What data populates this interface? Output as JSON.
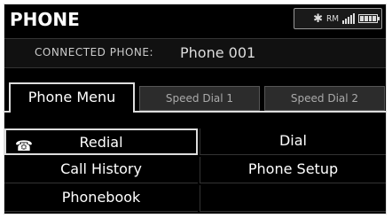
{
  "header": {
    "title": "PHONE",
    "status": {
      "bluetooth_icon": "bluetooth-icon",
      "roaming_text": "RM",
      "signal_icon": "signal-icon",
      "battery_icon": "battery-icon"
    }
  },
  "connected": {
    "label": "CONNECTED PHONE:",
    "phone_name": "Phone 001"
  },
  "tabs": [
    {
      "label": "Phone Menu",
      "active": true
    },
    {
      "label": "Speed Dial 1",
      "active": false
    },
    {
      "label": "Speed Dial 2",
      "active": false
    }
  ],
  "menu": {
    "redial": "Redial",
    "dial": "Dial",
    "call_history": "Call History",
    "phone_setup": "Phone Setup",
    "phonebook": "Phonebook"
  },
  "colors": {
    "background": "#000000",
    "text": "#ffffff",
    "tab_inactive": "#2c2c2c"
  }
}
